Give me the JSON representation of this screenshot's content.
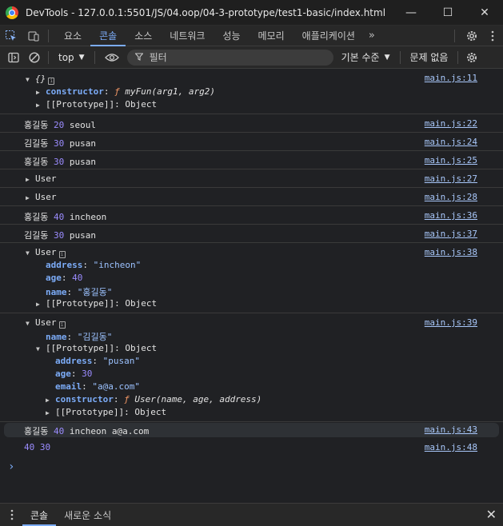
{
  "window": {
    "title": "DevTools - 127.0.0.1:5501/JS/04.oop/04-3-prototype/test1-basic/index.html",
    "minimize": "—",
    "maximize": "☐",
    "close": "✕"
  },
  "tabs": [
    {
      "label": "요소"
    },
    {
      "label": "콘솔",
      "active": true
    },
    {
      "label": "소스"
    },
    {
      "label": "네트워크"
    },
    {
      "label": "성능"
    },
    {
      "label": "메모리"
    },
    {
      "label": "애플리케이션"
    }
  ],
  "tabs_more": "»",
  "toolbar": {
    "context": "top",
    "filter_placeholder": "필터",
    "level": "기본 수준",
    "issues": "문제 없음"
  },
  "logs": {
    "r0": {
      "head": "{}",
      "src": "main.js:11",
      "constructor_key": "constructor",
      "constructor_f": "ƒ",
      "constructor_sig": "myFun(arg1, arg2)",
      "proto": "[[Prototype]]",
      "proto_val": "Object"
    },
    "r1": {
      "name": "홍길동",
      "age": "20",
      "city": "seoul",
      "src": "main.js:22"
    },
    "r2": {
      "name": "김길동",
      "age": "30",
      "city": "pusan",
      "src": "main.js:24"
    },
    "r3": {
      "name": "홍길동",
      "age": "30",
      "city": "pusan",
      "src": "main.js:25"
    },
    "r4": {
      "text": "User",
      "src": "main.js:27"
    },
    "r5": {
      "text": "User",
      "src": "main.js:28"
    },
    "r6": {
      "name": "홍길동",
      "age": "40",
      "city": "incheon",
      "src": "main.js:36"
    },
    "r7": {
      "name": "김길동",
      "age": "30",
      "city": "pusan",
      "src": "main.js:37"
    },
    "r8": {
      "head": "User",
      "src": "main.js:38",
      "address_key": "address",
      "address_val": "\"incheon\"",
      "age_key": "age",
      "age_val": "40",
      "name_key": "name",
      "name_val": "\"홍길동\"",
      "proto": "[[Prototype]]",
      "proto_val": "Object"
    },
    "r9": {
      "head": "User",
      "src": "main.js:39",
      "name_key": "name",
      "name_val": "\"김길동\"",
      "proto": "[[Prototype]]",
      "proto_val": "Object",
      "address_key": "address",
      "address_val": "\"pusan\"",
      "age_key": "age",
      "age_val": "30",
      "email_key": "email",
      "email_val": "\"a@a.com\"",
      "constructor_key": "constructor",
      "constructor_f": "ƒ",
      "constructor_sig": "User(name, age, address)",
      "proto2": "[[Prototype]]",
      "proto2_val": "Object"
    },
    "r10": {
      "name": "홍길동",
      "age": "40",
      "rest": "incheon a@a.com",
      "src": "main.js:43"
    },
    "r11": {
      "text": "40 30",
      "src": "main.js:48"
    }
  },
  "prompt": "›",
  "drawer": {
    "tabs": [
      {
        "label": "콘솔",
        "active": true
      },
      {
        "label": "새로운 소식"
      }
    ],
    "close": "✕"
  }
}
